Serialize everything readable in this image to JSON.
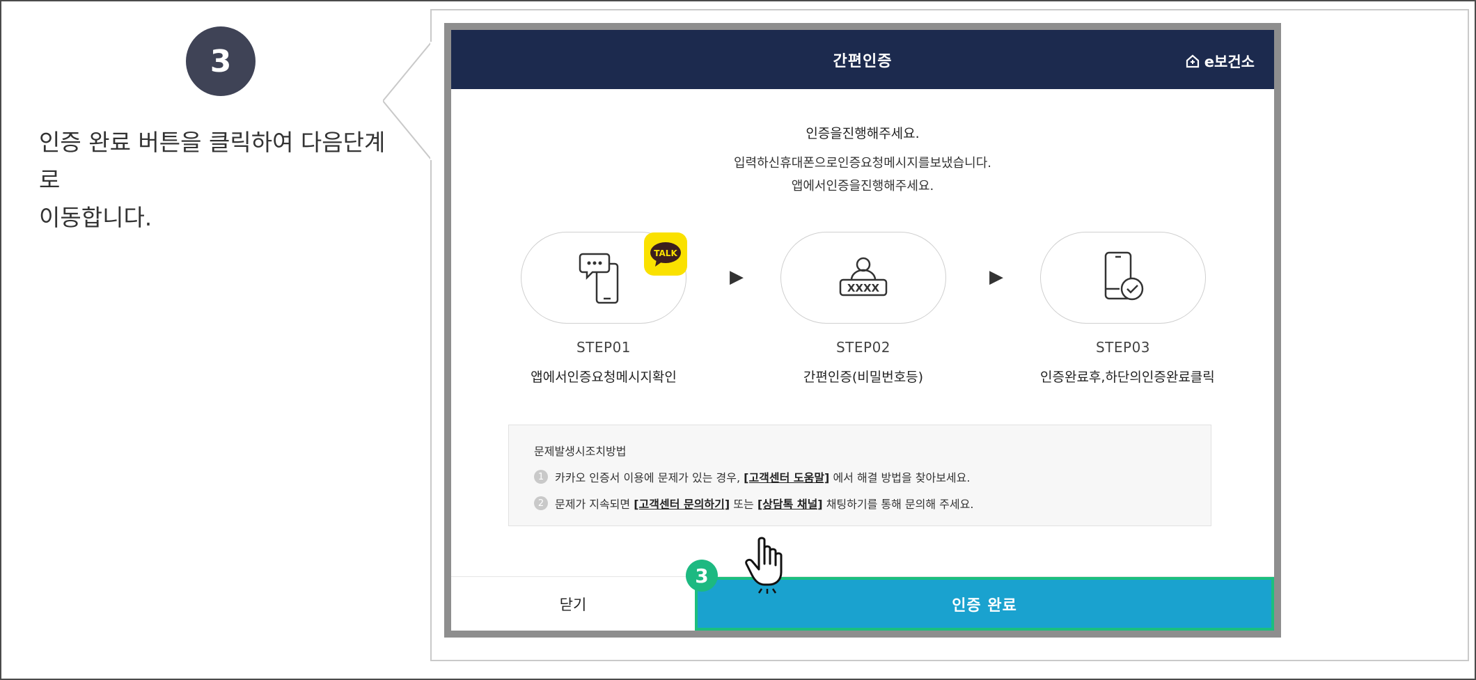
{
  "step": {
    "number": "3"
  },
  "instruction": {
    "line1": "인증 완료 버튼을 클릭하여 다음단계로",
    "line2": "이동합니다."
  },
  "modal": {
    "title": "간편인증",
    "brand": "e보건소",
    "lead": "인증을진행해주세요.",
    "sub_line1": "입력하신휴대폰으로인증요청메시지를보냈습니다.",
    "sub_line2": "앱에서인증을진행해주세요.",
    "steps": [
      {
        "label": "STEP01",
        "desc": "앱에서인증요청메시지확인",
        "icon": "chat-phone-icon"
      },
      {
        "label": "STEP02",
        "desc": "간편인증(비밀번호등)",
        "icon": "password-user-icon"
      },
      {
        "label": "STEP03",
        "desc": "인증완료후,하단의인증완료클릭",
        "icon": "phone-check-icon"
      }
    ],
    "talk_badge": "TALK",
    "arrow": "▶",
    "help": {
      "title": "문제발생시조치방법",
      "items": [
        {
          "num": "1",
          "pre": "카카오 인증서 이용에 문제가 있는 경우, ",
          "link": "[고객센터 도움말]",
          "post": " 에서 해결 방법을 찾아보세요."
        },
        {
          "num": "2",
          "pre": "문제가 지속되면 ",
          "link": "[고객센터 문의하기]",
          "mid": " 또는 ",
          "link2": "[상담톡 채널]",
          "post": " 채팅하기를 통해 문의해 주세요."
        }
      ]
    },
    "footer": {
      "close_label": "닫기",
      "done_label": "인증 완료"
    }
  },
  "marker": {
    "number": "3"
  },
  "colors": {
    "header": "#1c2a4e",
    "done": "#1aa2cf",
    "marker": "#1db981",
    "step_circle": "#3f4356",
    "talk": "#fae100"
  }
}
